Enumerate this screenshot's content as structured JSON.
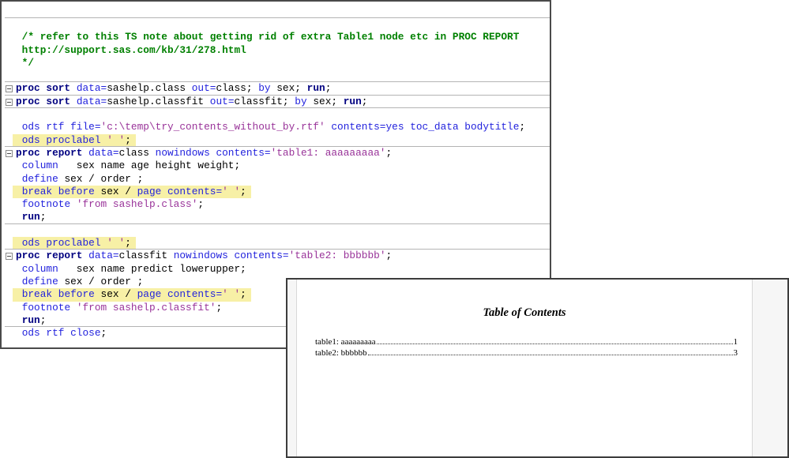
{
  "colors": {
    "keyword_navy": "#000080",
    "keyword_blue": "#2222dd",
    "string_purple": "#993399",
    "comment_green": "#008000",
    "highlight_yellow": "#f7f0a6",
    "divider_gray": "#b4b4b4"
  },
  "editor_window": {
    "rows": [
      {
        "blank": true,
        "div": true
      },
      {
        "seg": [
          [
            " /* refer to this TS note about getting rid of extra Table1 node etc in PROC REPORT",
            "c"
          ]
        ]
      },
      {
        "seg": [
          [
            " http://support.sas.com/kb/31/278.html",
            "c"
          ]
        ]
      },
      {
        "seg": [
          [
            " */",
            "c"
          ]
        ]
      },
      {
        "blank": true
      },
      {
        "box": true,
        "div": true,
        "seg": [
          [
            "proc sort",
            "k"
          ],
          [
            " ",
            "p"
          ],
          [
            "data=",
            "m"
          ],
          [
            "sashelp.class ",
            "p"
          ],
          [
            "out=",
            "m"
          ],
          [
            "class; ",
            "p"
          ],
          [
            "by",
            "m"
          ],
          [
            " sex; ",
            "p"
          ],
          [
            "run",
            "k"
          ],
          [
            ";",
            "p"
          ]
        ]
      },
      {
        "box": true,
        "div": true,
        "seg": [
          [
            "proc sort",
            "k"
          ],
          [
            " ",
            "p"
          ],
          [
            "data=",
            "m"
          ],
          [
            "sashelp.classfit ",
            "p"
          ],
          [
            "out=",
            "m"
          ],
          [
            "classfit; ",
            "p"
          ],
          [
            "by",
            "m"
          ],
          [
            " sex; ",
            "p"
          ],
          [
            "run",
            "k"
          ],
          [
            ";",
            "p"
          ]
        ]
      },
      {
        "blank": true,
        "div": true
      },
      {
        "seg": [
          [
            " ",
            "p"
          ],
          [
            "ods rtf file=",
            "m"
          ],
          [
            "'c:\\temp\\try_contents_without_by.rtf'",
            "s"
          ],
          [
            " ",
            "p"
          ],
          [
            "contents=yes toc_data bodytitle",
            "m"
          ],
          [
            ";",
            "p"
          ]
        ]
      },
      {
        "hl": true,
        "seg": [
          [
            " ",
            "p"
          ],
          [
            "ods proclabel ",
            "m"
          ],
          [
            "' '",
            "s"
          ],
          [
            ";",
            "p"
          ]
        ]
      },
      {
        "box": true,
        "div": true,
        "seg": [
          [
            "proc report",
            "k"
          ],
          [
            " ",
            "p"
          ],
          [
            "data=",
            "m"
          ],
          [
            "class ",
            "p"
          ],
          [
            "nowindows contents=",
            "m"
          ],
          [
            "'table1: aaaaaaaaa'",
            "s"
          ],
          [
            ";",
            "p"
          ]
        ]
      },
      {
        "seg": [
          [
            " ",
            "p"
          ],
          [
            "column",
            "m"
          ],
          [
            "   sex name age height weight;",
            "p"
          ]
        ]
      },
      {
        "seg": [
          [
            " ",
            "p"
          ],
          [
            "define",
            "m"
          ],
          [
            " sex / order ;",
            "p"
          ]
        ]
      },
      {
        "hl": true,
        "seg": [
          [
            " ",
            "p"
          ],
          [
            "break before",
            "m"
          ],
          [
            " sex / ",
            "p"
          ],
          [
            "page contents=",
            "m"
          ],
          [
            "' '",
            "s"
          ],
          [
            ";",
            "p"
          ]
        ]
      },
      {
        "seg": [
          [
            " ",
            "p"
          ],
          [
            "footnote",
            "m"
          ],
          [
            " ",
            "p"
          ],
          [
            "'from sashelp.class'",
            "s"
          ],
          [
            ";",
            "p"
          ]
        ]
      },
      {
        "seg": [
          [
            " ",
            "p"
          ],
          [
            "run",
            "k"
          ],
          [
            ";",
            "p"
          ]
        ]
      },
      {
        "blank": true,
        "div": true
      },
      {
        "hl": true,
        "seg": [
          [
            " ",
            "p"
          ],
          [
            "ods proclabel ",
            "m"
          ],
          [
            "' '",
            "s"
          ],
          [
            ";",
            "p"
          ]
        ]
      },
      {
        "box": true,
        "div": true,
        "seg": [
          [
            "proc report",
            "k"
          ],
          [
            " ",
            "p"
          ],
          [
            "data=",
            "m"
          ],
          [
            "classfit ",
            "p"
          ],
          [
            "nowindows contents=",
            "m"
          ],
          [
            "'table2: bbbbbb'",
            "s"
          ],
          [
            ";",
            "p"
          ]
        ]
      },
      {
        "seg": [
          [
            " ",
            "p"
          ],
          [
            "column",
            "m"
          ],
          [
            "   sex name predict lowerupper;",
            "p"
          ]
        ]
      },
      {
        "seg": [
          [
            " ",
            "p"
          ],
          [
            "define",
            "m"
          ],
          [
            " sex / order ;",
            "p"
          ]
        ]
      },
      {
        "hl": true,
        "seg": [
          [
            " ",
            "p"
          ],
          [
            "break before",
            "m"
          ],
          [
            " sex / ",
            "p"
          ],
          [
            "page contents=",
            "m"
          ],
          [
            "' '",
            "s"
          ],
          [
            ";",
            "p"
          ]
        ]
      },
      {
        "seg": [
          [
            " ",
            "p"
          ],
          [
            "footnote",
            "m"
          ],
          [
            " ",
            "p"
          ],
          [
            "'from sashelp.classfit'",
            "s"
          ],
          [
            ";",
            "p"
          ]
        ]
      },
      {
        "seg": [
          [
            " ",
            "p"
          ],
          [
            "run",
            "k"
          ],
          [
            ";",
            "p"
          ]
        ]
      },
      {
        "div": true,
        "seg": [
          [
            " ",
            "p"
          ],
          [
            "ods rtf close",
            "m"
          ],
          [
            ";",
            "p"
          ]
        ]
      }
    ]
  },
  "toc_window": {
    "title": "Table of Contents",
    "entries": [
      {
        "label": "table1: aaaaaaaaa",
        "page": "1"
      },
      {
        "label": "table2: bbbbbb",
        "page": "3"
      }
    ]
  }
}
